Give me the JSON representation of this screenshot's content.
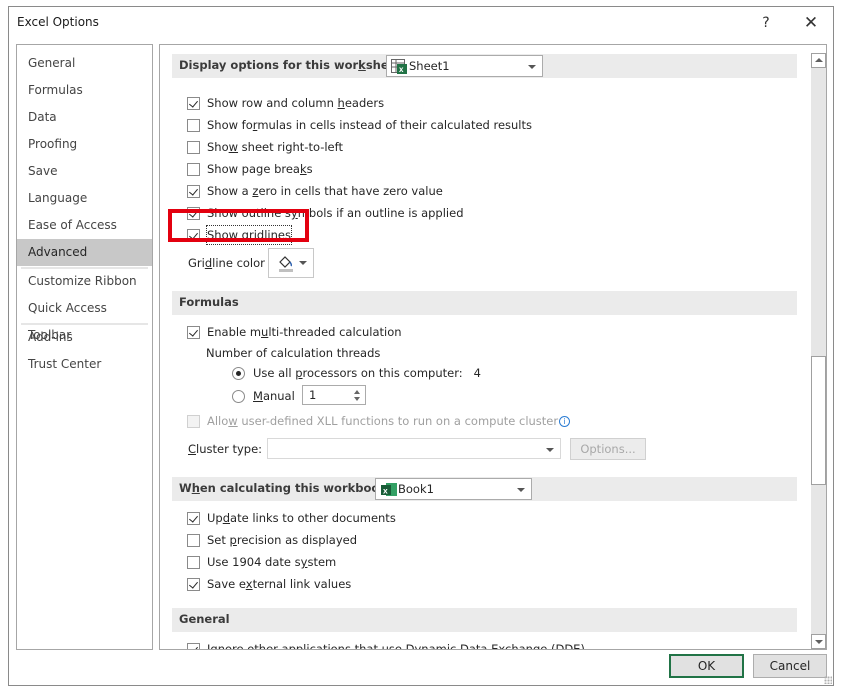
{
  "window": {
    "title": "Excel Options",
    "help_label": "?",
    "close_label": "✕"
  },
  "sidebar": {
    "items": [
      {
        "label": "General"
      },
      {
        "label": "Formulas"
      },
      {
        "label": "Data"
      },
      {
        "label": "Proofing"
      },
      {
        "label": "Save"
      },
      {
        "label": "Language"
      },
      {
        "label": "Ease of Access"
      },
      {
        "label": "Advanced",
        "selected": true
      },
      {
        "label": "Customize Ribbon"
      },
      {
        "label": "Quick Access Toolbar"
      },
      {
        "label": "Add-ins"
      },
      {
        "label": "Trust Center"
      }
    ]
  },
  "display_worksheet": {
    "header_pre": "Display options for this wor",
    "header_ul": "k",
    "header_post": "sheet:",
    "sheet_select": "Sheet1",
    "options": [
      {
        "pre": "Show row and column ",
        "ul": "h",
        "post": "eaders",
        "checked": true
      },
      {
        "pre": "Show fo",
        "ul": "r",
        "post": "mulas in cells instead of their calculated results",
        "checked": false
      },
      {
        "pre": "Sho",
        "ul": "w",
        "post": " sheet right-to-left",
        "checked": false
      },
      {
        "pre": "Show page brea",
        "ul": "k",
        "post": "s",
        "checked": false
      },
      {
        "pre": "Show a ",
        "ul": "z",
        "post": "ero in cells that have zero value",
        "checked": true
      },
      {
        "pre": "Show outline s",
        "ul": "y",
        "post": "mbols if an outline is applied",
        "checked": true
      },
      {
        "pre": "Show gri",
        "ul": "d",
        "post": "lines",
        "checked": true,
        "highlighted": true
      }
    ],
    "gridline_color_pre": "Gri",
    "gridline_color_ul": "d",
    "gridline_color_post": "line color",
    "gridline_color_value": "#c0c0c0"
  },
  "formulas": {
    "header": "Formulas",
    "multithread": {
      "pre": "Enable m",
      "ul": "u",
      "post": "lti-threaded calculation",
      "checked": true
    },
    "threads_label": "Number of calculation threads",
    "use_all": {
      "pre": "Use all ",
      "ul": "p",
      "post": "rocessors on this computer:",
      "selected": true,
      "count": "4"
    },
    "manual": {
      "ul": "M",
      "post": "anual",
      "selected": false,
      "value": "1"
    },
    "xll": {
      "pre": "Allo",
      "ul": "w",
      "post": " user-defined XLL functions to run on a compute cluster",
      "checked": false,
      "disabled": true
    },
    "info_icon": "i",
    "cluster_type_ul": "C",
    "cluster_type_post": "luster type:",
    "cluster_type_value": "",
    "options_button": "Options..."
  },
  "workbook": {
    "header_pre": "W",
    "header_ul": "h",
    "header_post": "en calculating this workbook:",
    "book_select": "Book1",
    "options": [
      {
        "pre": "Up",
        "ul": "d",
        "post": "ate links to other documents",
        "checked": true
      },
      {
        "pre": "Set ",
        "ul": "p",
        "post": "recision as displayed",
        "checked": false
      },
      {
        "pre": "Use 1904 date s",
        "ul": "y",
        "post": "stem",
        "checked": false
      },
      {
        "pre": "Save e",
        "ul": "x",
        "post": "ternal link values",
        "checked": true
      }
    ]
  },
  "general": {
    "header": "General",
    "dde": {
      "pre": "Ignore ",
      "ul": "o",
      "post": "ther applications that use Dynamic Data Exchange (DDE)",
      "checked": true
    }
  },
  "scroll": {
    "position_fraction": 0.66
  },
  "footer": {
    "ok_label": "OK",
    "cancel_label": "Cancel"
  },
  "colors": {
    "accent_green": "#217346",
    "highlight_red": "#e3000f",
    "selected_nav": "#c8c8c8",
    "section_bg": "#ebebeb"
  }
}
